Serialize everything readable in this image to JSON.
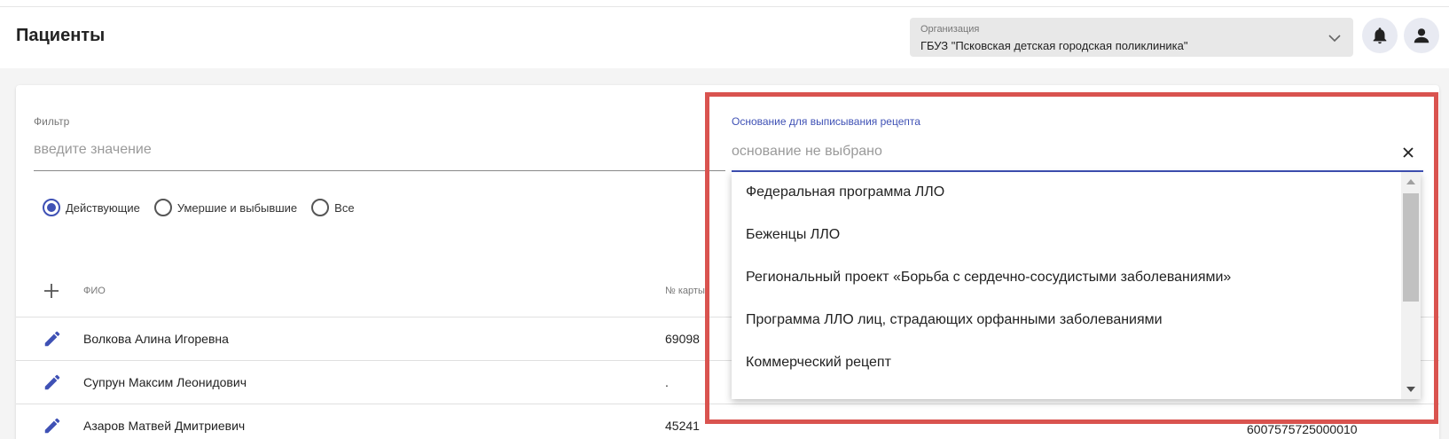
{
  "header": {
    "title": "Пациенты",
    "organization": {
      "label": "Организация",
      "value": "ГБУЗ \"Псковская детская городская поликлиника\""
    },
    "icons": [
      "bell-icon",
      "user-icon",
      "chevron-down-icon"
    ]
  },
  "filter": {
    "label": "Фильтр",
    "placeholder": "введите значение"
  },
  "status_radios": [
    {
      "label": "Действующие",
      "checked": true
    },
    {
      "label": "Умершие и выбывшие",
      "checked": false
    },
    {
      "label": "Все",
      "checked": false
    }
  ],
  "table": {
    "columns": [
      "ФИО",
      "№ карты"
    ],
    "rows": [
      {
        "name": "Волкова Алина Игоревна",
        "card": "69098",
        "extra": ""
      },
      {
        "name": "Супрун Максим Леонидович",
        "card": ".",
        "extra": ""
      },
      {
        "name": "Азаров Матвей Дмитриевич",
        "card": "45241",
        "extra": "6007575725000010"
      }
    ]
  },
  "prescription_basis": {
    "label": "Основание для выписывания рецепта",
    "placeholder": "основание не выбрано",
    "options": [
      "Федеральная программа ЛЛО",
      "Беженцы ЛЛО",
      "Региональный проект «Борьба с сердечно-сосудистыми заболеваниями»",
      "Программа ЛЛО лиц, страдающих орфанными заболеваниями",
      "Коммерческий рецепт"
    ]
  },
  "colors": {
    "accent": "#3f51b5",
    "highlight": "#d9534f"
  }
}
